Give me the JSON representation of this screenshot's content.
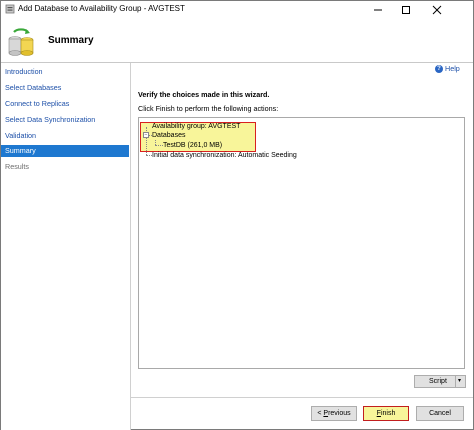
{
  "window": {
    "title": "Add Database to Availability Group - AVGTEST"
  },
  "header": {
    "title": "Summary"
  },
  "sidebar": {
    "items": [
      {
        "label": "Introduction",
        "state": "normal"
      },
      {
        "label": "Select Databases",
        "state": "normal"
      },
      {
        "label": "Connect to Replicas",
        "state": "normal"
      },
      {
        "label": "Select Data Synchronization",
        "state": "normal"
      },
      {
        "label": "Validation",
        "state": "normal"
      },
      {
        "label": "Summary",
        "state": "active"
      },
      {
        "label": "Results",
        "state": "disabled"
      }
    ]
  },
  "main": {
    "help_label": "Help",
    "verify_text": "Verify the choices made in this wizard.",
    "instruction_text": "Click Finish to perform the following actions:",
    "tree": {
      "availability_group": "Availability group: AVGTEST",
      "databases_label": "Databases",
      "database_entry": "TestDB (261,0 MB)",
      "sync": "Initial data synchronization: Automatic Seeding"
    }
  },
  "buttons": {
    "script": "Script",
    "previous_prefix": "< ",
    "previous_mnemonic": "P",
    "previous_rest": "revious",
    "finish_mnemonic": "F",
    "finish_rest": "inish",
    "cancel": "Cancel"
  },
  "colors": {
    "accent": "#1e78d0",
    "highlight": "#f8f59a",
    "highlight_border": "#d82020",
    "link": "#1c4fa8"
  }
}
